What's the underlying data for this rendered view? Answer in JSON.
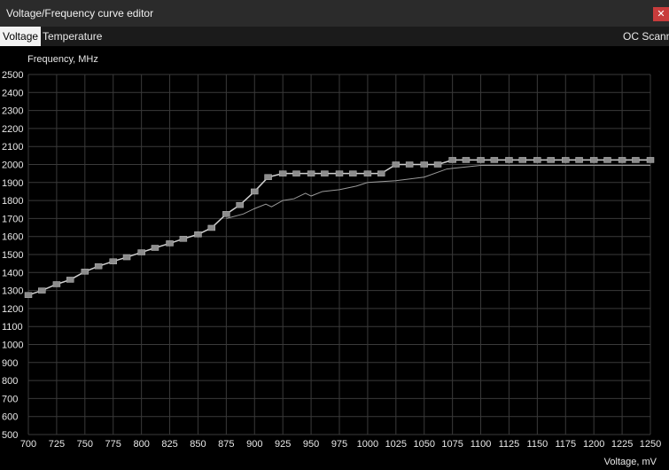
{
  "window": {
    "title": "Voltage/Frequency curve editor",
    "close_glyph": "✕"
  },
  "tabs": [
    {
      "label": "Voltage",
      "active": true
    },
    {
      "label": "Temperature",
      "active": false
    }
  ],
  "oc_scanner_label": "OC Scanner",
  "colors": {
    "background": "#000000",
    "grid": "#3a3a3a",
    "curve": "#d0d0d0",
    "point": "#8c8c8c",
    "close": "#c83c3c"
  },
  "chart_data": {
    "type": "line",
    "ylabel": "Frequency, MHz",
    "xlabel": "Voltage, mV",
    "xlim": [
      700,
      1250
    ],
    "ylim": [
      500,
      2500
    ],
    "x_ticks": [
      700,
      725,
      750,
      775,
      800,
      825,
      850,
      875,
      900,
      925,
      950,
      975,
      1000,
      1025,
      1050,
      1075,
      1100,
      1125,
      1150,
      1175,
      1200,
      1225,
      1250
    ],
    "y_ticks": [
      500,
      600,
      700,
      800,
      900,
      1000,
      1100,
      1200,
      1300,
      1400,
      1500,
      1600,
      1700,
      1800,
      1900,
      2000,
      2100,
      2200,
      2300,
      2400,
      2500
    ],
    "grid": true,
    "series": [
      {
        "role": "curve-points",
        "x": [
          700,
          712,
          725,
          737,
          750,
          762,
          775,
          787,
          800,
          812,
          825,
          837,
          850,
          862,
          875,
          887,
          900,
          912,
          925,
          937,
          950,
          962,
          975,
          987,
          1000,
          1012,
          1025,
          1037,
          1050,
          1062,
          1075,
          1087,
          1100,
          1112,
          1125,
          1137,
          1150,
          1162,
          1175,
          1187,
          1200,
          1212,
          1225,
          1237,
          1250
        ],
        "y": [
          1275,
          1300,
          1335,
          1360,
          1405,
          1435,
          1462,
          1485,
          1512,
          1537,
          1562,
          1587,
          1612,
          1648,
          1725,
          1775,
          1850,
          1930,
          1950,
          1950,
          1950,
          1950,
          1950,
          1950,
          1950,
          1950,
          2000,
          2000,
          2000,
          2000,
          2025,
          2025,
          2025,
          2025,
          2025,
          2025,
          2025,
          2025,
          2025,
          2025,
          2025,
          2025,
          2025,
          2025,
          2025
        ]
      },
      {
        "role": "reference-curve",
        "x": [
          875,
          890,
          900,
          910,
          915,
          925,
          935,
          945,
          950,
          960,
          975,
          990,
          1000,
          1025,
          1050,
          1070,
          1100,
          1250
        ],
        "y": [
          1700,
          1725,
          1755,
          1780,
          1765,
          1800,
          1810,
          1840,
          1825,
          1850,
          1860,
          1880,
          1900,
          1910,
          1930,
          1975,
          1995,
          1995
        ]
      }
    ]
  }
}
